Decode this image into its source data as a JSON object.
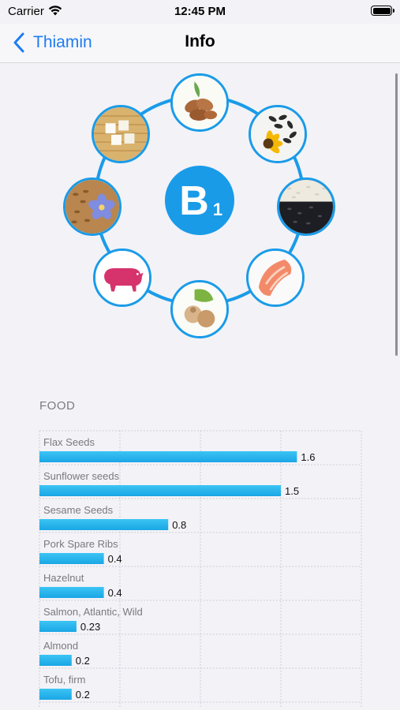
{
  "status_bar": {
    "carrier": "Carrier",
    "time": "12:45 PM"
  },
  "nav": {
    "back_label": "Thiamin",
    "title": "Info"
  },
  "vitamin_badge": {
    "letter": "B",
    "subscript": "1",
    "color": "#1a9be8"
  },
  "diagram_items": [
    {
      "name": "almonds-image"
    },
    {
      "name": "sunflower-seeds-image"
    },
    {
      "name": "sesame-seeds-image"
    },
    {
      "name": "salmon-image"
    },
    {
      "name": "hazelnuts-image"
    },
    {
      "name": "pork-image"
    },
    {
      "name": "flax-seeds-image"
    },
    {
      "name": "tofu-image"
    }
  ],
  "section": {
    "title": "FOOD"
  },
  "chart_data": {
    "type": "bar",
    "orientation": "horizontal",
    "categories": [
      "Flax Seeds",
      "Sunflower seeds",
      "Sesame Seeds",
      "Pork Spare Ribs",
      "Hazelnut",
      "Salmon, Atlantic, Wild",
      "Almond",
      "Tofu, firm"
    ],
    "values": [
      1.6,
      1.5,
      0.8,
      0.4,
      0.4,
      0.23,
      0.2,
      0.2
    ],
    "value_labels": [
      "1.6",
      "1.5",
      "0.8",
      "0.4",
      "0.4",
      "0.23",
      "0.2",
      "0.2"
    ],
    "xlim": [
      0,
      2.0
    ],
    "x_ticks": [
      "0",
      "0.5",
      "1.0",
      "1.5",
      "2.0"
    ],
    "grid": true,
    "bar_color": "#1aa6e6"
  }
}
